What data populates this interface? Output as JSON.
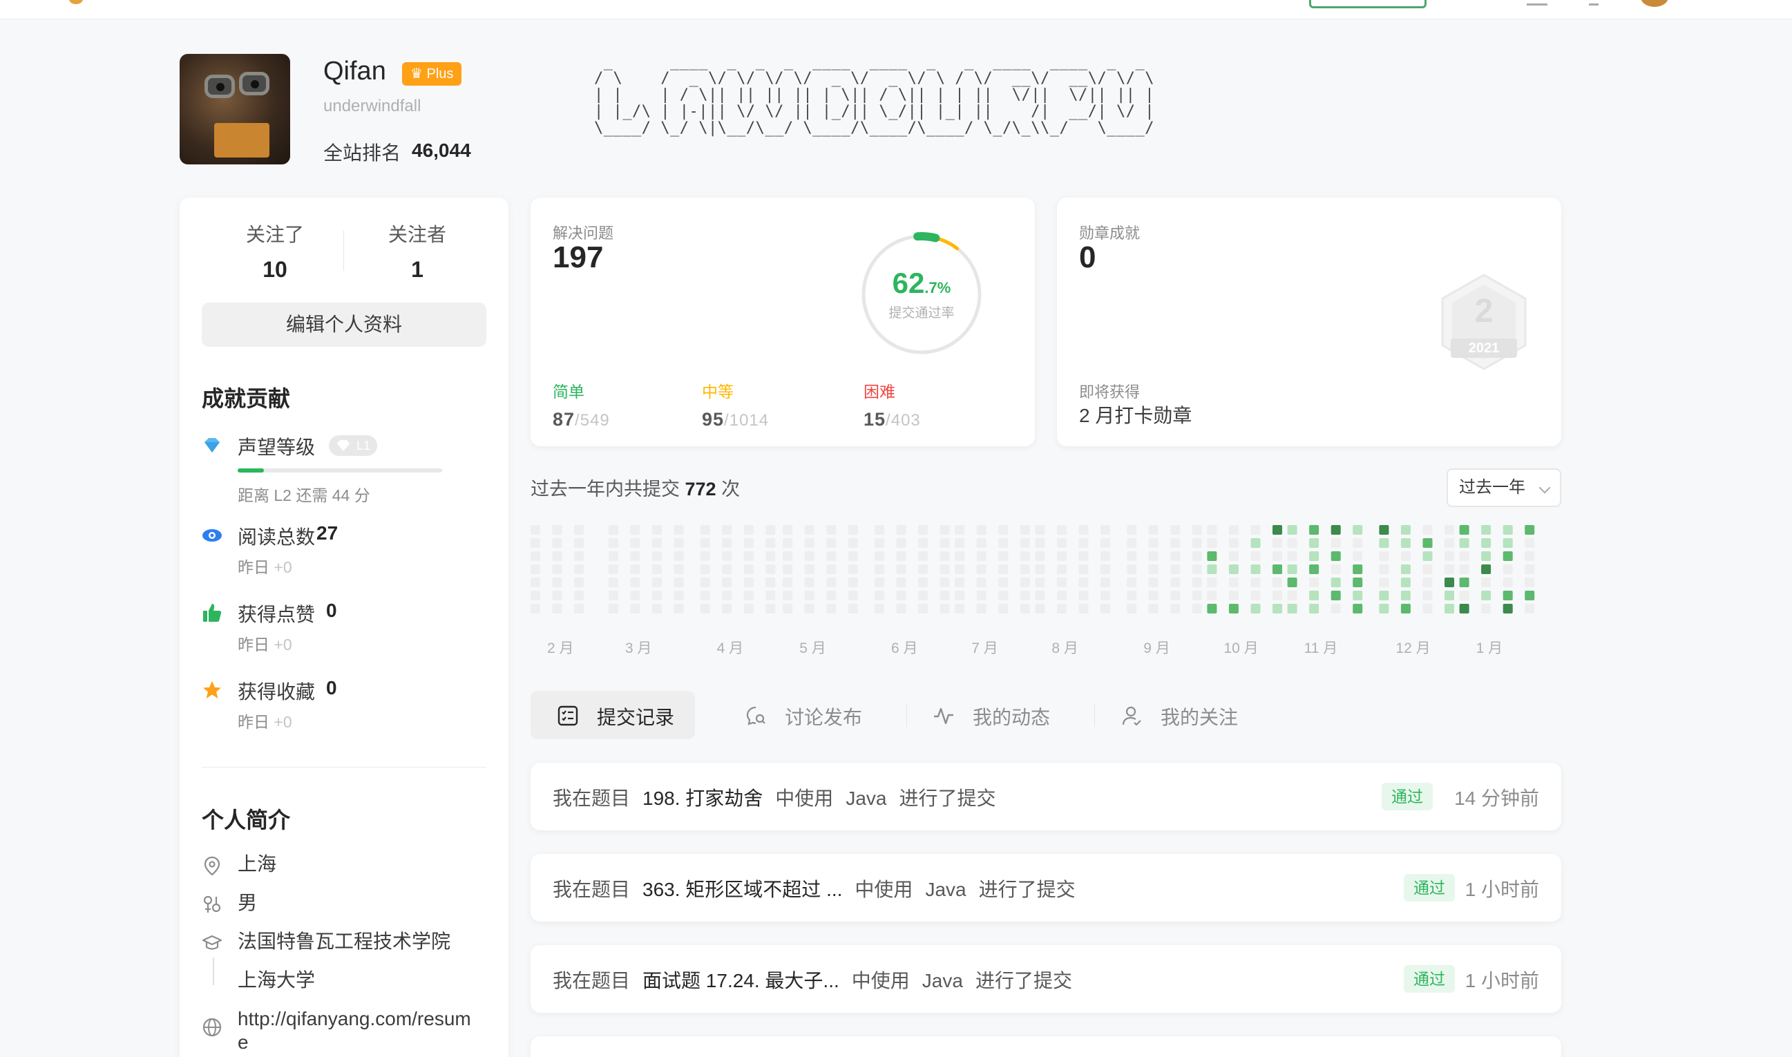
{
  "profile": {
    "name": "Qifan",
    "plus_label": "Plus",
    "handle": "underwindfall",
    "rank_label": "全站排名",
    "rank_value": "46,044",
    "ascii_art": " _      ____  _  _  _  ____  ____  _   _  ____  ____  _  _ \n/ \\    /  _ \\/ \\/ \\/ \\/  _ \\/  _ \\/ \\ / \\/  __\\/  __\\/ \\/ \\\n| |    | / \\|| || || || | \\|| / \\|| | | ||  \\/||  \\/|| || |\n| |_/\\ | |-||| \\/ \\/ || |_/|| \\_/|| |_| ||    /|  __/| \\/ |\n\\____/ \\_/ \\|\\__/\\__/ \\____/\\____/\\____/ \\_/\\_\\\\_/   \\____/"
  },
  "follow": {
    "following_label": "关注了",
    "following_value": "10",
    "followers_label": "关注者",
    "followers_value": "1"
  },
  "edit_profile_label": "编辑个人资料",
  "contributions": {
    "title": "成就贡献",
    "reputation": {
      "label": "声望等级",
      "level": "L1",
      "progress": 0.13,
      "sub": "距离 L2 还需 44 分"
    },
    "reads": {
      "label": "阅读总数",
      "value": "27",
      "sub": "昨日",
      "delta": "+0"
    },
    "likes": {
      "label": "获得点赞",
      "value": "0",
      "sub": "昨日",
      "delta": "+0"
    },
    "favorites": {
      "label": "获得收藏",
      "value": "0",
      "sub": "昨日",
      "delta": "+0"
    }
  },
  "bio": {
    "title": "个人简介",
    "location": "上海",
    "gender": "男",
    "school1": "法国特鲁瓦工程技术学院",
    "school2": "上海大学",
    "website_line1": "http://qifanyang.com/resum",
    "website_line2": "e"
  },
  "solved": {
    "label": "解决问题",
    "value": "197",
    "acceptance": 0.627,
    "acceptance_big": "62",
    "acceptance_small": ".7%",
    "acceptance_label": "提交通过率",
    "easy": {
      "label": "简单",
      "solved": "87",
      "total": "/549",
      "color": "#2db55d"
    },
    "medium": {
      "label": "中等",
      "solved": "95",
      "total": "/1014",
      "color": "#ffb800"
    },
    "hard": {
      "label": "困难",
      "solved": "15",
      "total": "/403",
      "color": "#ef4743"
    }
  },
  "badges": {
    "label": "勋章成就",
    "value": "0",
    "upcoming_label": "即将获得",
    "upcoming_name": "2 月打卡勋章",
    "hex_number": "2",
    "hex_year": "2021"
  },
  "submissions": {
    "prefix": "过去一年内共提交",
    "count": "772",
    "suffix": "次",
    "range_label": "过去一年",
    "months": [
      "2 月",
      "3 月",
      "4 月",
      "5 月",
      "6 月",
      "7 月",
      "8 月",
      "9 月",
      "10 月",
      "11 月",
      "12 月",
      "1 月"
    ]
  },
  "tabs": [
    {
      "label": "提交记录",
      "icon": "list-check-icon",
      "active": true
    },
    {
      "label": "讨论发布",
      "icon": "chat-search-icon",
      "active": false
    },
    {
      "label": "我的动态",
      "icon": "activity-icon",
      "active": false
    },
    {
      "label": "我的关注",
      "icon": "user-icon",
      "active": false
    }
  ],
  "records": [
    {
      "prefix": "我在题目",
      "problem": "198. 打家劫舍",
      "mid": "中使用",
      "lang": "Java",
      "suffix": "进行了提交",
      "status": "通过",
      "time": "14 分钟前"
    },
    {
      "prefix": "我在题目",
      "problem": "363. 矩形区域不超过 ...",
      "mid": "中使用",
      "lang": "Java",
      "suffix": "进行了提交",
      "status": "通过",
      "time": "1 小时前"
    },
    {
      "prefix": "我在题目",
      "problem": "面试题 17.24. 最大子...",
      "mid": "中使用",
      "lang": "Java",
      "suffix": "进行了提交",
      "status": "通过",
      "time": "1 小时前"
    }
  ]
}
